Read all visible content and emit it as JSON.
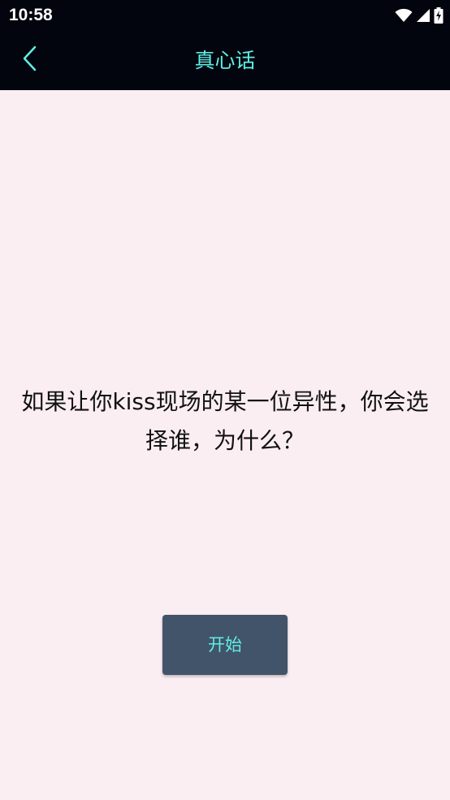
{
  "status_bar": {
    "time": "10:58",
    "icons": [
      "wifi-icon",
      "signal-icon",
      "battery-charging-icon"
    ]
  },
  "toolbar": {
    "back_icon": "chevron-left-icon",
    "title": "真心话"
  },
  "main": {
    "question": "如果让你kiss现场的某一位异性，你会选择谁，为什么？",
    "start_button_label": "开始"
  },
  "colors": {
    "status_bar_bg": "#02050d",
    "toolbar_bg": "#02050d",
    "accent": "#5fefe6",
    "page_bg": "#fbeef2",
    "button_bg": "#425469",
    "question_text": "#111111"
  }
}
